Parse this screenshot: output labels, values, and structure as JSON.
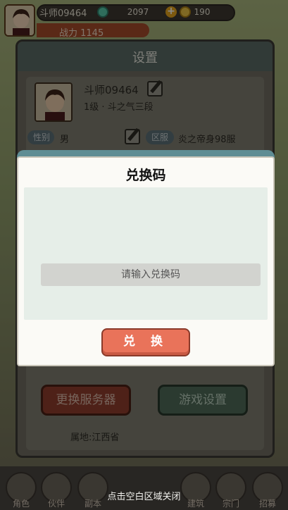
{
  "player": {
    "name": "斗师09464",
    "power": "战力 1145",
    "gems": "2097",
    "coins": "190"
  },
  "settings": {
    "title": "设置",
    "player_name": "斗师09464",
    "level_text": "1级 · 斗之气三段",
    "gender_label": "性别",
    "gender_value": "男",
    "server_label": "区服",
    "server_value": "炎之帝身98服",
    "change_server_label": "更换服务器",
    "game_settings_label": "游戏设置",
    "location": "属地:江西省"
  },
  "modal": {
    "title": "兑换码",
    "input_placeholder": "请输入兑换码",
    "input_value": "",
    "redeem_label": "兑 换"
  },
  "bottom_nav": {
    "items": [
      {
        "label": "角色"
      },
      {
        "label": "伙伴"
      },
      {
        "label": "副本"
      },
      {
        "label": "建筑"
      },
      {
        "label": "宗门"
      },
      {
        "label": "招募"
      }
    ],
    "close_hint": "点击空白区域关闭"
  },
  "colors": {
    "redeem_button": "#e9735a",
    "modal_background": "#fbfaf6",
    "input_background": "#d2d3cf"
  }
}
